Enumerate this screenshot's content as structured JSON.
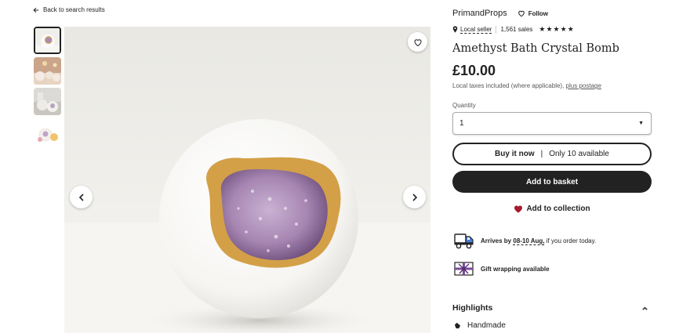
{
  "nav": {
    "back_label": "Back to search results"
  },
  "gallery": {
    "thumbnails": [
      "thumb-1",
      "thumb-2",
      "thumb-3",
      "thumb-4"
    ],
    "active_index": 0
  },
  "seller": {
    "shop_name": "PrimandProps",
    "follow_label": "Follow",
    "local_seller_label": "Local seller",
    "sales": "1,561 sales",
    "rating": 5
  },
  "product": {
    "title": "Amethyst Bath Crystal Bomb",
    "price": "£10.00",
    "tax_note": "Local taxes included (where applicable),",
    "postage_link": "plus postage"
  },
  "quantity": {
    "label": "Quantity",
    "selected": "1"
  },
  "actions": {
    "buy_now": "Buy it now",
    "availability": "Only 10 available",
    "add_to_basket": "Add to basket",
    "add_to_collection": "Add to collection"
  },
  "shipping": {
    "arrives_prefix": "Arrives by",
    "date_range": "08-10 Aug,",
    "arrives_suffix": "if you order today."
  },
  "gift": {
    "label": "Gift wrapping available"
  },
  "highlights": {
    "title": "Highlights",
    "items": [
      "Handmade"
    ]
  },
  "colors": {
    "text": "#222222",
    "muted": "#595959",
    "heart": "#a61a2e",
    "gift_purple": "#7a4a9e"
  }
}
